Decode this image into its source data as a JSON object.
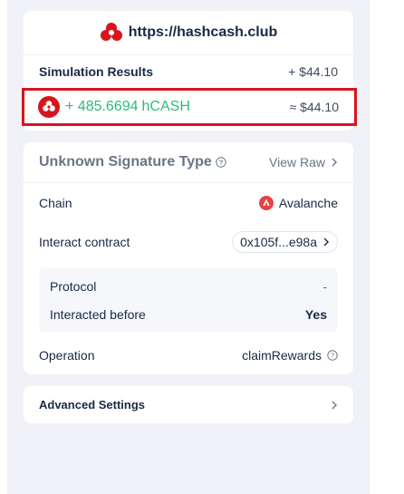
{
  "site": {
    "url": "https://hashcash.club",
    "logo_icon": "hashcash-logo-icon"
  },
  "simulation": {
    "title": "Simulation Results",
    "total_usd": "+ $44.10",
    "token": {
      "amount": "+ 485.6694",
      "symbol": "hCASH",
      "usd": "≈ $44.10",
      "icon": "hashcash-token-icon"
    }
  },
  "signature": {
    "title": "Unknown Signature Type",
    "view_raw": "View Raw",
    "chain_label": "Chain",
    "chain_value": "Avalanche",
    "contract_label": "Interact contract",
    "contract_value": "0x105f...e98a",
    "protocol_label": "Protocol",
    "protocol_value": "-",
    "interacted_label": "Interacted before",
    "interacted_value": "Yes",
    "operation_label": "Operation",
    "operation_value": "claimRewards"
  },
  "advanced": {
    "label": "Advanced Settings"
  },
  "colors": {
    "accent_green": "#2abb7f",
    "highlight_red": "#d7151d",
    "avalanche_red": "#e84142"
  }
}
